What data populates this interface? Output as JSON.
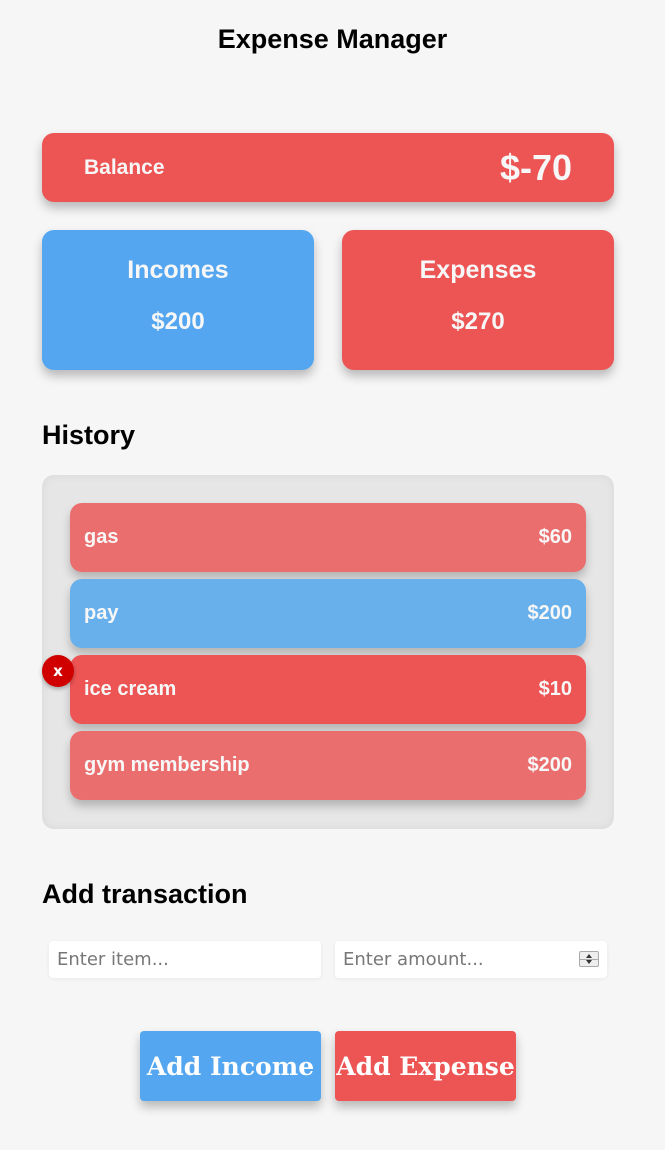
{
  "app": {
    "title": "Expense Manager"
  },
  "balance": {
    "label": "Balance",
    "value": "$-70"
  },
  "summary": {
    "income": {
      "label": "Incomes",
      "value": "$200"
    },
    "expense": {
      "label": "Expenses",
      "value": "$270"
    }
  },
  "history": {
    "heading": "History",
    "items": [
      {
        "name": "gas",
        "amount": "$60",
        "type": "expense"
      },
      {
        "name": "pay",
        "amount": "$200",
        "type": "income"
      },
      {
        "name": "ice cream",
        "amount": "$10",
        "type": "expense"
      },
      {
        "name": "gym membership",
        "amount": "$200",
        "type": "expense"
      }
    ],
    "delete_label": "x"
  },
  "add_transaction": {
    "heading": "Add transaction",
    "item_placeholder": "Enter item...",
    "amount_placeholder": "Enter amount...",
    "item_value": "",
    "amount_value": "",
    "add_income_label": "Add Income",
    "add_expense_label": "Add Expense"
  },
  "colors": {
    "income": "#53a6ef",
    "expense": "#ed5454",
    "delete": "#d00000"
  }
}
